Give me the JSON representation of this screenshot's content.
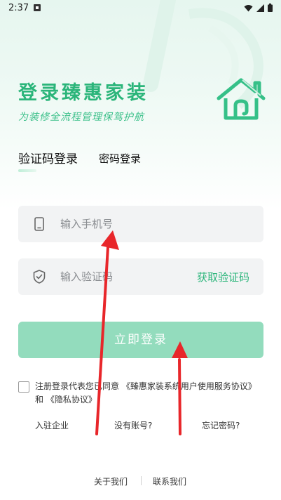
{
  "status_bar": {
    "time": "2:37"
  },
  "header": {
    "title": "登录臻惠家装",
    "subtitle": "为装修全流程管理保驾护航"
  },
  "tabs": {
    "active": "验证码登录",
    "inactive": "密码登录"
  },
  "phone_field": {
    "placeholder": "输入手机号"
  },
  "code_field": {
    "placeholder": "输入验证码",
    "get_code_label": "获取验证码"
  },
  "login_button": {
    "label": "立即登录"
  },
  "agreement": {
    "prefix": "注册登录代表您已同意",
    "user_agreement": "《臻惠家装系统用户使用服务协议》",
    "and": "和",
    "privacy_policy": "《隐私协议》"
  },
  "links": {
    "enterprise": "入驻企业",
    "no_account": "没有账号?",
    "forgot_password": "忘记密码?"
  },
  "footer": {
    "about": "关于我们",
    "contact": "联系我们"
  },
  "colors": {
    "accent": "#2bb57a",
    "button": "#93dcbd",
    "field_bg": "#f2f3f4",
    "annotation_arrow": "#e8262a"
  },
  "icons": [
    "notification-icon",
    "wifi-icon",
    "signal-icon",
    "battery-icon",
    "house-logo-icon",
    "phone-icon",
    "shield-check-icon",
    "checkbox-icon"
  ]
}
